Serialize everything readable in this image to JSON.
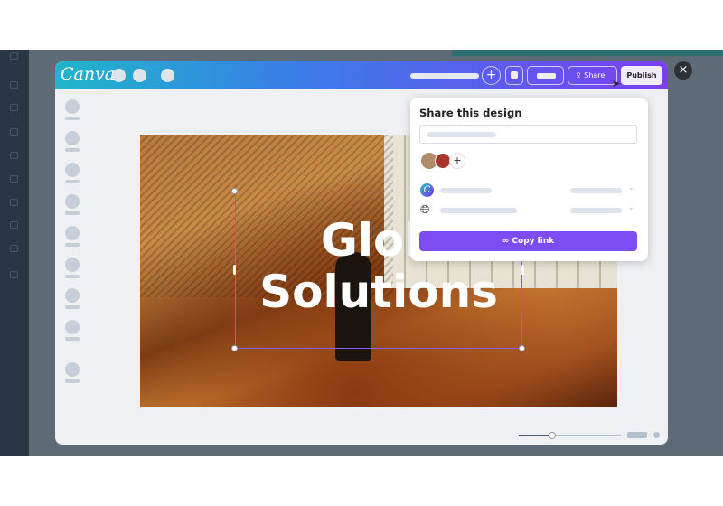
{
  "app": {
    "logo": "Canva"
  },
  "toolbar": {
    "share_label": "Share",
    "publish_label": "Publish",
    "add_icon": "plus-icon",
    "share_icon": "upload-icon"
  },
  "headline": {
    "line1": "Glob",
    "line2": "Solutions"
  },
  "share_panel": {
    "title": "Share this design",
    "copy_label": "Copy link",
    "add_people": "+",
    "link_icon": "link-icon",
    "globe_icon": "globe-icon"
  },
  "close": "×",
  "zoom": {
    "level_fraction": 0.32
  },
  "colors": {
    "accent": "#7d4cf2",
    "teal": "#1fb6c9"
  }
}
